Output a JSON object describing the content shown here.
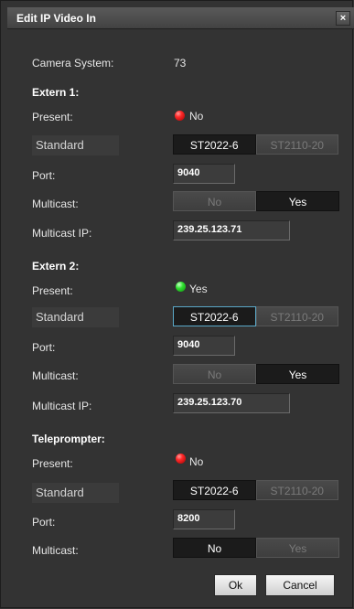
{
  "dialog": {
    "title": "Edit IP Video In",
    "close_glyph": "×"
  },
  "camera_system": {
    "label": "Camera System:",
    "value": "73"
  },
  "labels": {
    "present": "Present:",
    "standard": "Standard",
    "port": "Port:",
    "multicast": "Multicast:",
    "multicast_ip": "Multicast IP:"
  },
  "extern1": {
    "title": "Extern 1:",
    "present": {
      "status": "No",
      "color": "#ff2a2a"
    },
    "standard": {
      "options": [
        "ST2022-6",
        "ST2110-20"
      ],
      "selected": "ST2022-6"
    },
    "port": "9040",
    "multicast": {
      "options": [
        "No",
        "Yes"
      ],
      "selected": "Yes"
    },
    "multicast_ip": "239.25.123.71"
  },
  "extern2": {
    "title": "Extern 2:",
    "present": {
      "status": "Yes",
      "color": "#2fe02f"
    },
    "standard": {
      "options": [
        "ST2022-6",
        "ST2110-20"
      ],
      "selected": "ST2022-6"
    },
    "port": "9040",
    "multicast": {
      "options": [
        "No",
        "Yes"
      ],
      "selected": "Yes"
    },
    "multicast_ip": "239.25.123.70"
  },
  "teleprompter": {
    "title": "Teleprompter:",
    "present": {
      "status": "No",
      "color": "#ff2a2a"
    },
    "standard": {
      "options": [
        "ST2022-6",
        "ST2110-20"
      ],
      "selected": "ST2022-6"
    },
    "port": "8200",
    "multicast": {
      "options": [
        "No",
        "Yes"
      ],
      "selected": "No"
    }
  },
  "buttons": {
    "ok": "Ok",
    "cancel": "Cancel"
  }
}
